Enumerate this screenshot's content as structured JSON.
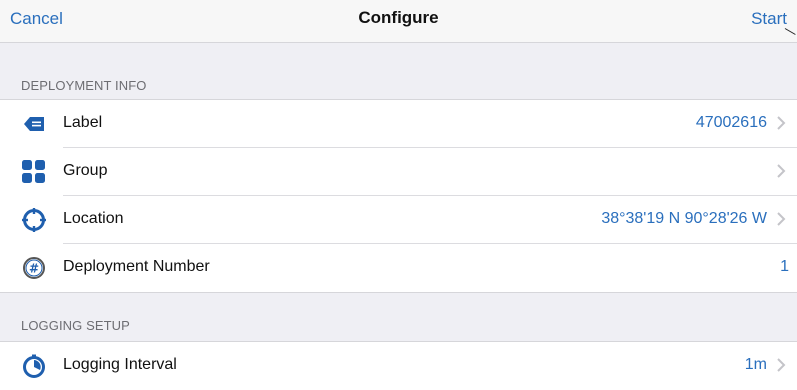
{
  "navbar": {
    "cancel_label": "Cancel",
    "title": "Configure",
    "start_label": "Start"
  },
  "sections": [
    {
      "header": "DEPLOYMENT INFO",
      "rows": [
        {
          "icon": "tag-icon",
          "label": "Label",
          "value": "47002616",
          "disclosure": true
        },
        {
          "icon": "grid-icon",
          "label": "Group",
          "value": "",
          "disclosure": true
        },
        {
          "icon": "crosshair-icon",
          "label": "Location",
          "value": "38°38'19 N 90°28'26 W",
          "disclosure": true
        },
        {
          "icon": "hash-icon",
          "label": "Deployment Number",
          "value": "1",
          "disclosure": false
        }
      ]
    },
    {
      "header": "LOGGING SETUP",
      "rows": [
        {
          "icon": "timer-icon",
          "label": "Logging Interval",
          "value": "1m",
          "disclosure": true
        }
      ]
    }
  ],
  "colors": {
    "accent": "#2a6fbd",
    "icon_blue": "#1f5fae",
    "background": "#efeff4"
  }
}
